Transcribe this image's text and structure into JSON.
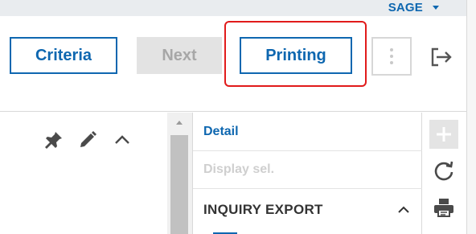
{
  "user": {
    "name": "SAGE"
  },
  "toolbar": {
    "criteria_label": "Criteria",
    "next_label": "Next",
    "printing_label": "Printing"
  },
  "menu": {
    "detail_label": "Detail",
    "display_selection_label": "Display sel.",
    "section_title": "INQUIRY EXPORT"
  },
  "colors": {
    "accent": "#0e67b0",
    "highlight": "#e11b1b",
    "disabled": "#a7a7a7"
  },
  "icons": [
    "caret-down-icon",
    "more-vertical-icon",
    "exit-icon",
    "pin-icon",
    "pencil-icon",
    "chevron-up-icon",
    "plus-icon",
    "refresh-icon",
    "print-icon"
  ]
}
